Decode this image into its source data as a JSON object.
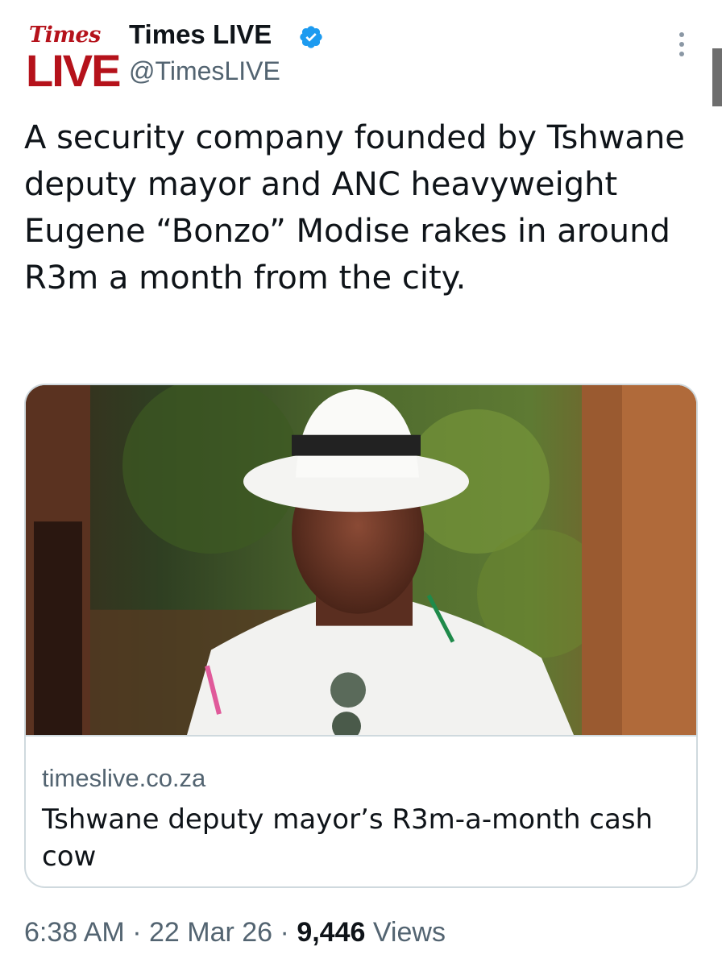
{
  "header": {
    "avatar_top": "Times",
    "avatar_bottom": "LIVE",
    "display_name": "Times LIVE",
    "handle": "@TimesLIVE",
    "verified_icon": "verified-badge-icon",
    "more_icon": "more-vertical-icon"
  },
  "tweet": {
    "text": "A security company founded by Tshwane deputy mayor and ANC heavyweight Eugene “Bonzo” Modise rakes in around R3m a month from the city."
  },
  "card": {
    "image": "photo of man in white fedora and white shirt outdoors",
    "domain": "timeslive.co.za",
    "title": "Tshwane deputy mayor’s R3m-a-month cash cow"
  },
  "meta": {
    "time": "6:38 AM",
    "date": "22 Mar 26",
    "views_count": "9,446",
    "views_label": "Views",
    "separator": "·"
  },
  "colors": {
    "brand_red": "#b5121b",
    "verified_blue": "#1d9bf0",
    "secondary_text": "#536471",
    "primary_text": "#0f1419",
    "card_border": "#cfd9de"
  }
}
